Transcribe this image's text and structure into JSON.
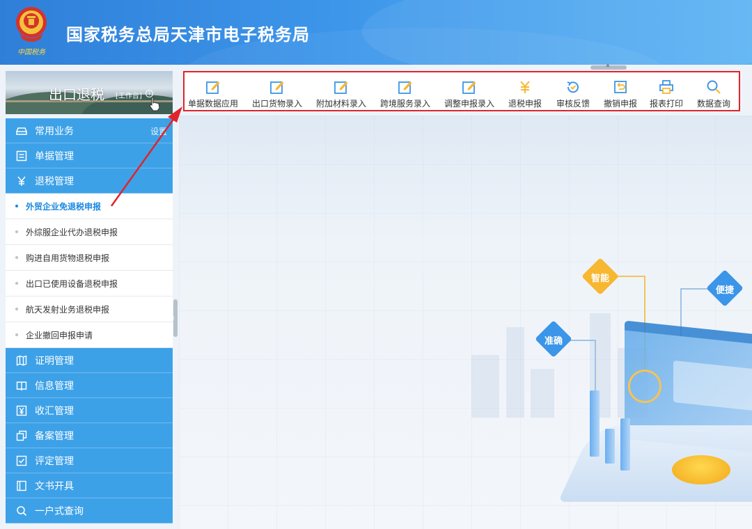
{
  "header": {
    "title": "国家税务总局天津市电子税务局",
    "emblem_text": "中国税务"
  },
  "sidebar": {
    "banner_title": "出口退税",
    "banner_tag": "[工作台]",
    "settings_label": "设置",
    "menu": [
      {
        "label": "常用业务",
        "icon": "car-icon"
      },
      {
        "label": "单据管理",
        "icon": "list-icon"
      },
      {
        "label": "退税管理",
        "icon": "yuan-icon"
      }
    ],
    "submenu": [
      {
        "label": "外贸企业免退税申报",
        "active": true
      },
      {
        "label": "外综服企业代办退税申报",
        "active": false
      },
      {
        "label": "购进自用货物退税申报",
        "active": false
      },
      {
        "label": "出口已使用设备退税申报",
        "active": false
      },
      {
        "label": "航天发射业务退税申报",
        "active": false
      },
      {
        "label": "企业撤回申报申请",
        "active": false
      }
    ],
    "menu_bottom": [
      {
        "label": "证明管理",
        "icon": "map-icon"
      },
      {
        "label": "信息管理",
        "icon": "book-icon"
      },
      {
        "label": "收汇管理",
        "icon": "yen-box-icon"
      },
      {
        "label": "备案管理",
        "icon": "copy-icon"
      },
      {
        "label": "评定管理",
        "icon": "checkbox-icon"
      },
      {
        "label": "文书开具",
        "icon": "document-icon"
      },
      {
        "label": "一户式查询",
        "icon": "search-icon"
      }
    ]
  },
  "toolbar": {
    "items": [
      {
        "label": "单据数据应用",
        "icon": "edit-icon"
      },
      {
        "label": "出口货物录入",
        "icon": "edit-icon"
      },
      {
        "label": "附加材料录入",
        "icon": "edit-icon"
      },
      {
        "label": "跨境服务录入",
        "icon": "edit-icon"
      },
      {
        "label": "调整申报录入",
        "icon": "edit-icon"
      },
      {
        "label": "退税申报",
        "icon": "yuan-icon"
      },
      {
        "label": "审核反馈",
        "icon": "refresh-check-icon"
      },
      {
        "label": "撤销申报",
        "icon": "undo-icon"
      },
      {
        "label": "报表打印",
        "icon": "print-icon"
      },
      {
        "label": "数据查询",
        "icon": "search-icon"
      }
    ]
  },
  "illustration": {
    "tags": [
      "智能",
      "便捷",
      "准确"
    ]
  },
  "colors": {
    "header_blue": "#3d96ea",
    "menu_blue": "#3da1e8",
    "active_blue": "#1a88e0",
    "highlight_red": "#e1232b",
    "tag_orange": "#f7b731",
    "tag_blue": "#3b95e8"
  }
}
